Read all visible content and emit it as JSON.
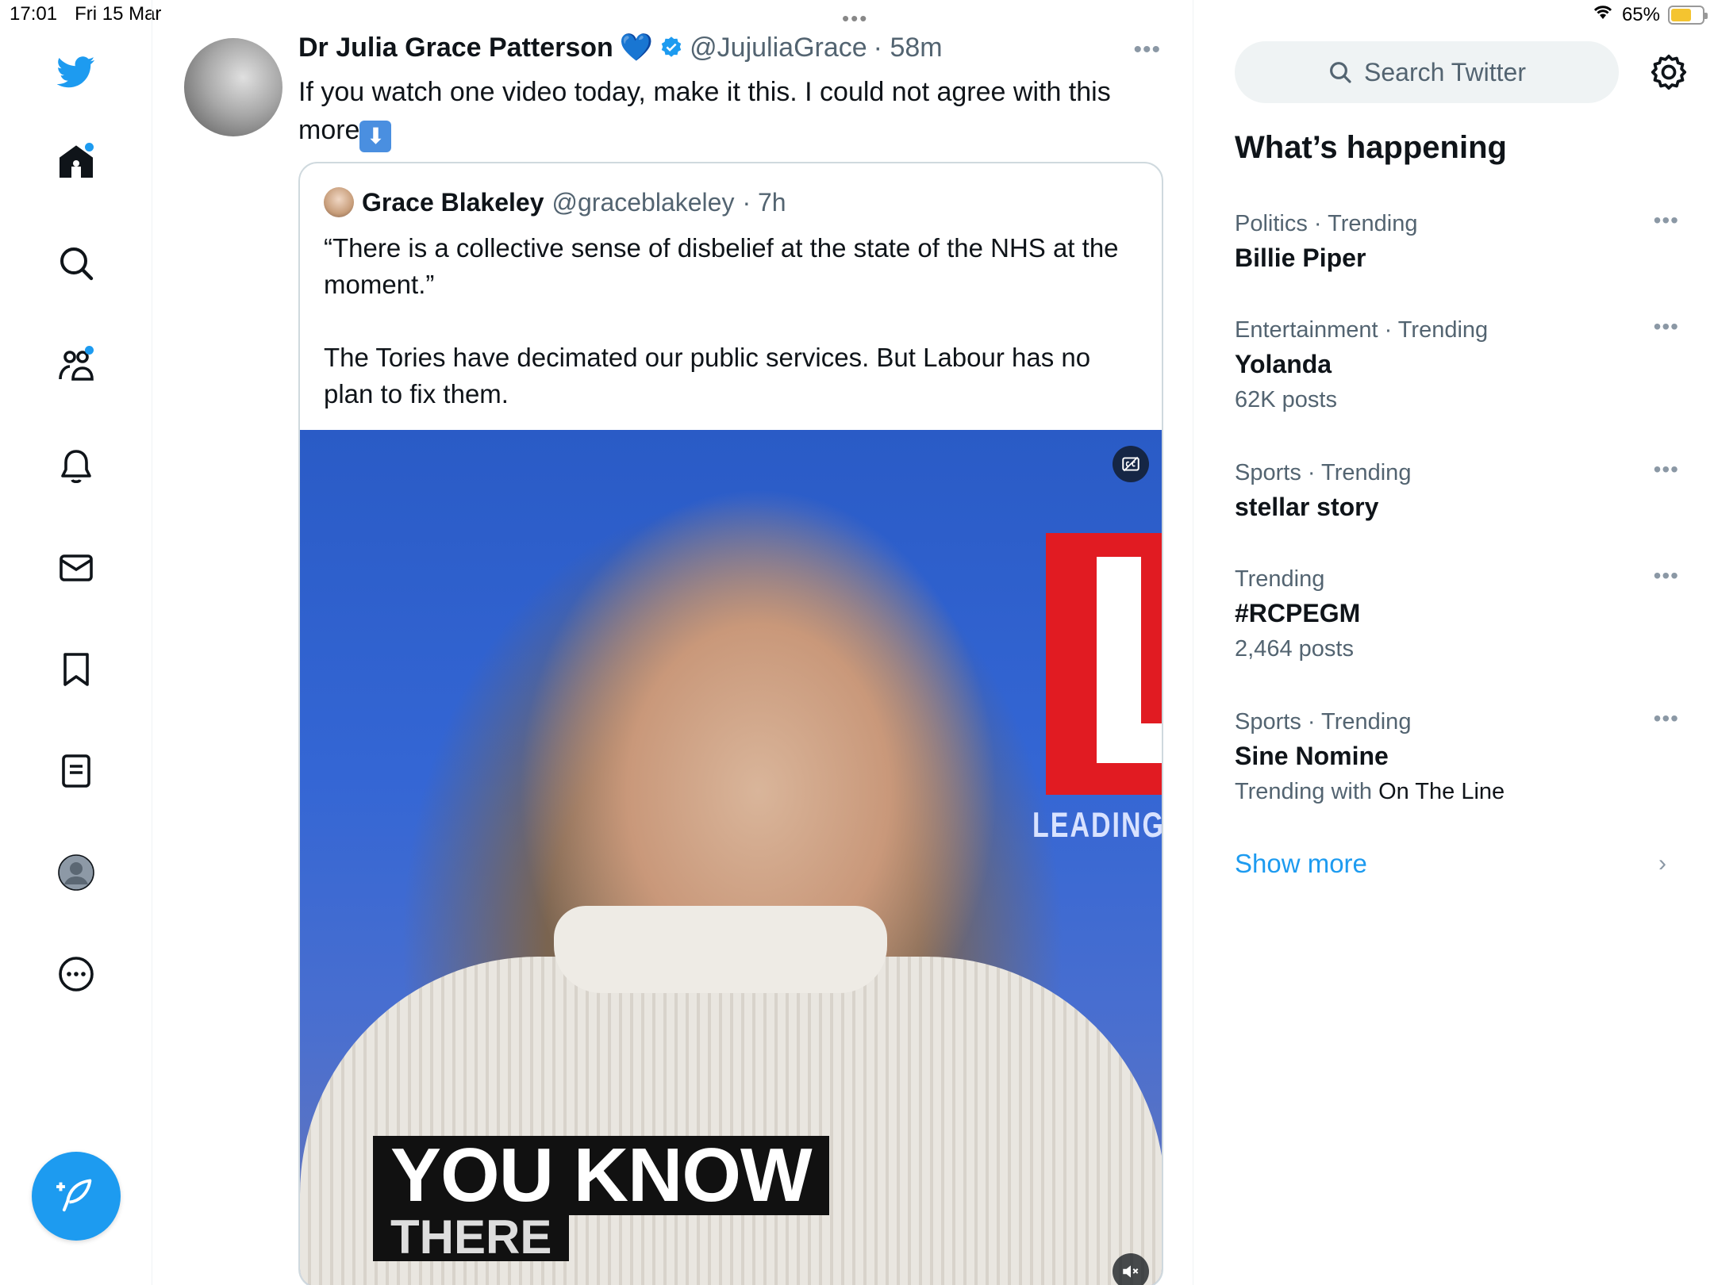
{
  "status_bar": {
    "time": "17:01",
    "date": "Fri 15 Mar",
    "battery": "65%",
    "battery_level": 0.65,
    "battery_color": "#f4c430"
  },
  "colors": {
    "accent": "#1d9bf0",
    "text": "#0f1419",
    "muted": "#536471"
  },
  "nav": {
    "items": [
      {
        "icon": "twitter-bird-icon"
      },
      {
        "icon": "home-icon",
        "badge": true
      },
      {
        "icon": "search-icon"
      },
      {
        "icon": "communities-icon",
        "badge": true
      },
      {
        "icon": "notifications-bell-icon"
      },
      {
        "icon": "messages-envelope-icon"
      },
      {
        "icon": "bookmark-icon"
      },
      {
        "icon": "lists-icon"
      },
      {
        "icon": "profile-avatar-icon"
      },
      {
        "icon": "more-circle-icon"
      }
    ],
    "compose_icon": "compose-feather-icon"
  },
  "tweet": {
    "author_name": "Dr Julia Grace Patterson",
    "author_emoji": "💙",
    "handle": "@JujuliaGrace",
    "time": "· 58m",
    "text": "If you watch one video today, make it this. I could not agree with this more",
    "text_emoji": "⬇",
    "quote": {
      "author_name": "Grace Blakeley",
      "handle": "@graceblakeley",
      "time": "· 7h",
      "paragraphs": [
        "“There is a collective sense of disbelief at the state of the NHS at the moment.”",
        "The Tories have decimated our public services. But Labour has no plan to fix them."
      ],
      "video": {
        "caption_line1": "YOU KNOW",
        "caption_line2": "THERE",
        "sign_text": "LEADING"
      }
    }
  },
  "sidebar": {
    "search_placeholder": "Search Twitter",
    "section_title": "What’s happening",
    "trends": [
      {
        "meta": "Politics · Trending",
        "name": "Billie Piper",
        "sub": ""
      },
      {
        "meta": "Entertainment · Trending",
        "name": "Yolanda",
        "sub": "62K posts"
      },
      {
        "meta": "Sports · Trending",
        "name": "stellar story",
        "sub": ""
      },
      {
        "meta": "Trending",
        "name": "#RCPEGM",
        "sub": "2,464 posts"
      },
      {
        "meta": "Sports · Trending",
        "name": "Sine Nomine",
        "sub_prefix": "Trending with",
        "sub_link": "On The Line"
      }
    ],
    "show_more": "Show more"
  }
}
